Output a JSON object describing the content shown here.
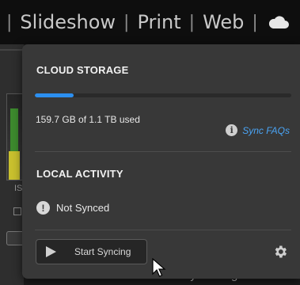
{
  "header": {
    "modules": [
      "Slideshow",
      "Print",
      "Web"
    ],
    "separator": "|",
    "cloud_icon": "cloud-icon"
  },
  "background": {
    "left_label": "IS",
    "bottom_text": "Keywording"
  },
  "cloud_storage": {
    "title": "CLOUD STORAGE",
    "usage_text": "159.7 GB of 1.1 TB used",
    "used_fraction": 0.15,
    "bar_color": "#2c8ff0",
    "faq_icon": "info-icon",
    "faq_label": "Sync FAQs"
  },
  "local_activity": {
    "title": "LOCAL ACTIVITY",
    "status_icon": "warning-icon",
    "status_text": "Not Synced"
  },
  "footer": {
    "sync_button_label": "Start Syncing",
    "sync_button_icon": "play-icon",
    "settings_icon": "gear-icon"
  }
}
